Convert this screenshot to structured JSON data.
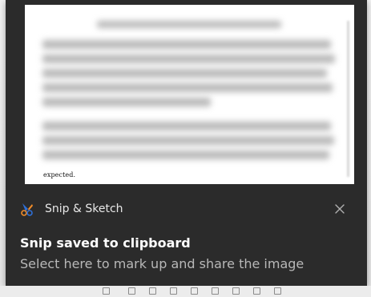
{
  "notification": {
    "thumbnail_caption": "expected.",
    "app_name": "Snip & Sketch",
    "title": "Snip saved to clipboard",
    "body": "Select here to mark up and share the image",
    "close_icon": "close-icon",
    "app_icon": "snip-sketch-icon"
  },
  "colors": {
    "toast_background": "#2b2b2b",
    "title_text": "#ffffff",
    "body_text": "#b8b8b8",
    "app_icon_blue": "#2f6fd6",
    "app_icon_orange": "#f28c28"
  }
}
